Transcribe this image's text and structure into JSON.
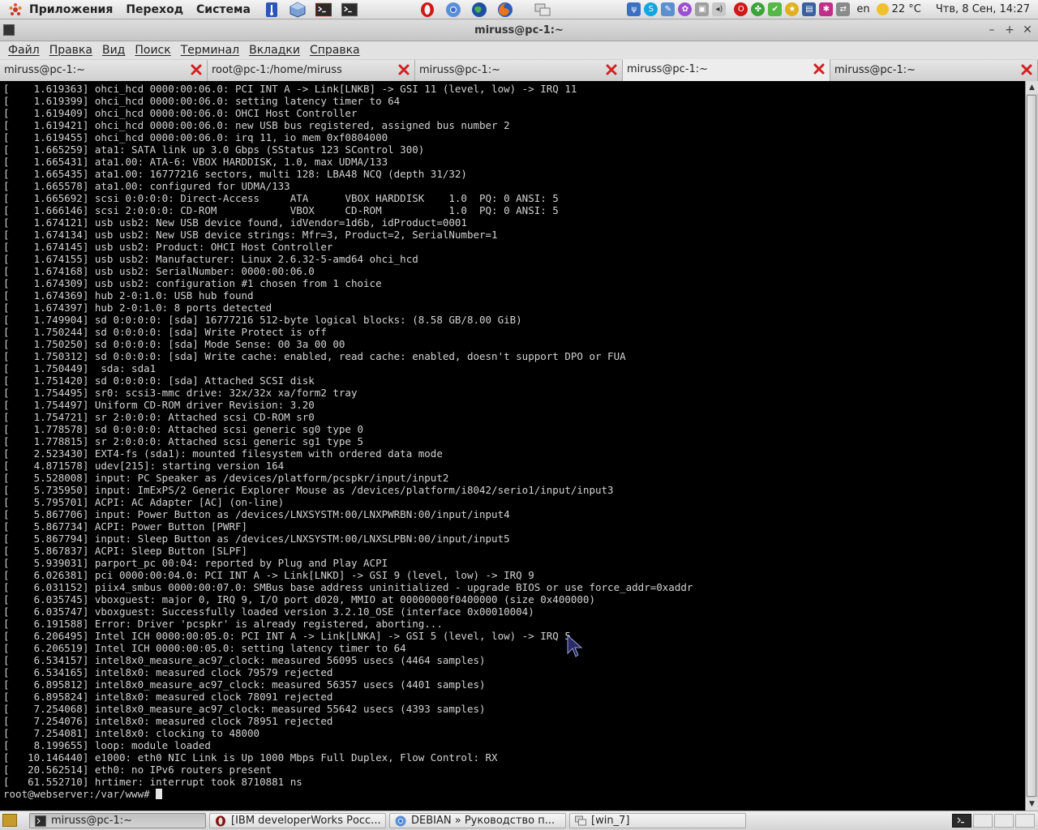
{
  "top_panel": {
    "menus": [
      "Приложения",
      "Переход",
      "Система"
    ],
    "language": "en",
    "weather": "22 °C",
    "clock": "Чтв,  8 Сен, 14:27"
  },
  "window": {
    "title": "miruss@pc-1:~"
  },
  "menubar": [
    "Файл",
    "Правка",
    "Вид",
    "Поиск",
    "Терминал",
    "Вкладки",
    "Справка"
  ],
  "tabs": [
    {
      "label": "miruss@pc-1:~",
      "active": false
    },
    {
      "label": "root@pc-1:/home/miruss",
      "active": false
    },
    {
      "label": "miruss@pc-1:~",
      "active": false
    },
    {
      "label": "miruss@pc-1:~",
      "active": true
    },
    {
      "label": "miruss@pc-1:~",
      "active": false
    }
  ],
  "terminal": {
    "lines": [
      "[    1.619363] ohci_hcd 0000:00:06.0: PCI INT A -> Link[LNKB] -> GSI 11 (level, low) -> IRQ 11",
      "[    1.619399] ohci_hcd 0000:00:06.0: setting latency timer to 64",
      "[    1.619409] ohci_hcd 0000:00:06.0: OHCI Host Controller",
      "[    1.619421] ohci_hcd 0000:00:06.0: new USB bus registered, assigned bus number 2",
      "[    1.619455] ohci_hcd 0000:00:06.0: irq 11, io mem 0xf0804000",
      "[    1.665259] ata1: SATA link up 3.0 Gbps (SStatus 123 SControl 300)",
      "[    1.665431] ata1.00: ATA-6: VBOX HARDDISK, 1.0, max UDMA/133",
      "[    1.665435] ata1.00: 16777216 sectors, multi 128: LBA48 NCQ (depth 31/32)",
      "[    1.665578] ata1.00: configured for UDMA/133",
      "[    1.665692] scsi 0:0:0:0: Direct-Access     ATA      VBOX HARDDISK    1.0  PQ: 0 ANSI: 5",
      "[    1.666146] scsi 2:0:0:0: CD-ROM            VBOX     CD-ROM           1.0  PQ: 0 ANSI: 5",
      "[    1.674121] usb usb2: New USB device found, idVendor=1d6b, idProduct=0001",
      "[    1.674134] usb usb2: New USB device strings: Mfr=3, Product=2, SerialNumber=1",
      "[    1.674145] usb usb2: Product: OHCI Host Controller",
      "[    1.674155] usb usb2: Manufacturer: Linux 2.6.32-5-amd64 ohci_hcd",
      "[    1.674168] usb usb2: SerialNumber: 0000:00:06.0",
      "[    1.674309] usb usb2: configuration #1 chosen from 1 choice",
      "[    1.674369] hub 2-0:1.0: USB hub found",
      "[    1.674397] hub 2-0:1.0: 8 ports detected",
      "[    1.749904] sd 0:0:0:0: [sda] 16777216 512-byte logical blocks: (8.58 GB/8.00 GiB)",
      "[    1.750244] sd 0:0:0:0: [sda] Write Protect is off",
      "[    1.750250] sd 0:0:0:0: [sda] Mode Sense: 00 3a 00 00",
      "[    1.750312] sd 0:0:0:0: [sda] Write cache: enabled, read cache: enabled, doesn't support DPO or FUA",
      "[    1.750449]  sda: sda1",
      "[    1.751420] sd 0:0:0:0: [sda] Attached SCSI disk",
      "[    1.754495] sr0: scsi3-mmc drive: 32x/32x xa/form2 tray",
      "[    1.754497] Uniform CD-ROM driver Revision: 3.20",
      "[    1.754721] sr 2:0:0:0: Attached scsi CD-ROM sr0",
      "[    1.778578] sd 0:0:0:0: Attached scsi generic sg0 type 0",
      "[    1.778815] sr 2:0:0:0: Attached scsi generic sg1 type 5",
      "[    2.523430] EXT4-fs (sda1): mounted filesystem with ordered data mode",
      "[    4.871578] udev[215]: starting version 164",
      "[    5.528008] input: PC Speaker as /devices/platform/pcspkr/input/input2",
      "[    5.735950] input: ImExPS/2 Generic Explorer Mouse as /devices/platform/i8042/serio1/input/input3",
      "[    5.795701] ACPI: AC Adapter [AC] (on-line)",
      "[    5.867706] input: Power Button as /devices/LNXSYSTM:00/LNXPWRBN:00/input/input4",
      "[    5.867734] ACPI: Power Button [PWRF]",
      "[    5.867794] input: Sleep Button as /devices/LNXSYSTM:00/LNXSLPBN:00/input/input5",
      "[    5.867837] ACPI: Sleep Button [SLPF]",
      "[    5.939031] parport_pc 00:04: reported by Plug and Play ACPI",
      "[    6.026381] pci 0000:00:04.0: PCI INT A -> Link[LNKD] -> GSI 9 (level, low) -> IRQ 9",
      "[    6.031152] piix4_smbus 0000:00:07.0: SMBus base address uninitialized - upgrade BIOS or use force_addr=0xaddr",
      "[    6.035745] vboxguest: major 0, IRQ 9, I/O port d020, MMIO at 00000000f0400000 (size 0x400000)",
      "[    6.035747] vboxguest: Successfully loaded version 3.2.10_OSE (interface 0x00010004)",
      "[    6.191588] Error: Driver 'pcspkr' is already registered, aborting...",
      "[    6.206495] Intel ICH 0000:00:05.0: PCI INT A -> Link[LNKA] -> GSI 5 (level, low) -> IRQ 5",
      "[    6.206519] Intel ICH 0000:00:05.0: setting latency timer to 64",
      "[    6.534157] intel8x0_measure_ac97_clock: measured 56095 usecs (4464 samples)",
      "[    6.534165] intel8x0: measured clock 79579 rejected",
      "[    6.895812] intel8x0_measure_ac97_clock: measured 56357 usecs (4401 samples)",
      "[    6.895824] intel8x0: measured clock 78091 rejected",
      "[    7.254068] intel8x0_measure_ac97_clock: measured 55642 usecs (4393 samples)",
      "[    7.254076] intel8x0: measured clock 78951 rejected",
      "[    7.254081] intel8x0: clocking to 48000",
      "[    8.199655] loop: module loaded",
      "[   10.146440] e1000: eth0 NIC Link is Up 1000 Mbps Full Duplex, Flow Control: RX",
      "[   20.562514] eth0: no IPv6 routers present",
      "[   61.552710] hrtimer: interrupt took 8710881 ns"
    ],
    "prompt": "root@webserver:/var/www# "
  },
  "taskbar": {
    "tasks": [
      {
        "label": "miruss@pc-1:~",
        "icon": "terminal-icon",
        "active": true
      },
      {
        "label": "[IBM developerWorks Росс...",
        "icon": "opera-icon",
        "active": false
      },
      {
        "label": "DEBIAN » Руководство п...",
        "icon": "chromium-icon",
        "active": false
      },
      {
        "label": "[win_7]",
        "icon": "network-icon",
        "active": false
      }
    ]
  },
  "colors": {
    "terminal_bg": "#000000",
    "terminal_fg": "#d3d3d3",
    "close_red": "#d42020"
  }
}
